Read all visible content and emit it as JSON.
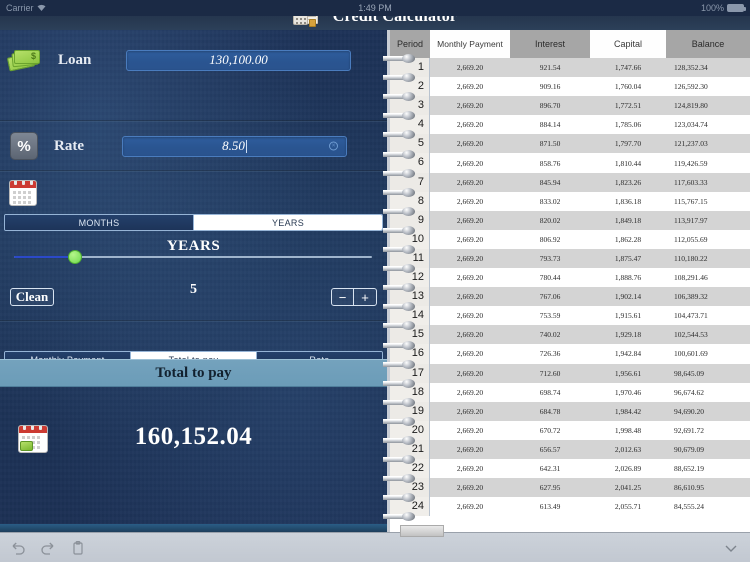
{
  "status_bar": {
    "carrier": "Carrier",
    "time": "1:49 PM",
    "battery": "100%"
  },
  "header": {
    "title": "Credit Calculator",
    "icon": "calculator-receipt-icon"
  },
  "left_panel": {
    "loan": {
      "icon": "money-bills-icon",
      "label": "Loan",
      "value": "130,100.00"
    },
    "rate": {
      "icon": "percent-icon",
      "label": "Rate",
      "value": "8.50"
    },
    "term": {
      "icon": "calendar-icon",
      "segments": [
        {
          "label": "MONTHS",
          "selected": false
        },
        {
          "label": "YEARS",
          "selected": true
        }
      ],
      "title": "YEARS",
      "value": "5",
      "slider_percent": 17,
      "clean_label": "Clean",
      "stepper_minus": "−",
      "stepper_plus": "+"
    },
    "result": {
      "segments": [
        {
          "label": "Monthly Payment",
          "selected": false
        },
        {
          "label": "Total to pay",
          "selected": true
        },
        {
          "label": "Rate",
          "selected": false
        }
      ],
      "header": "Total to pay",
      "icon": "calendar-money-icon",
      "value": "160,152.04"
    }
  },
  "table": {
    "columns": [
      {
        "label": "Period",
        "style": "gray"
      },
      {
        "label": "Monthly Payment",
        "style": "white"
      },
      {
        "label": "Interest",
        "style": "gray"
      },
      {
        "label": "Capital",
        "style": "white"
      },
      {
        "label": "Balance",
        "style": "gray"
      }
    ],
    "rows": [
      [
        "1",
        "2,669.20",
        "921.54",
        "1,747.66",
        "128,352.34"
      ],
      [
        "2",
        "2,669.20",
        "909.16",
        "1,760.04",
        "126,592.30"
      ],
      [
        "3",
        "2,669.20",
        "896.70",
        "1,772.51",
        "124,819.80"
      ],
      [
        "4",
        "2,669.20",
        "884.14",
        "1,785.06",
        "123,034.74"
      ],
      [
        "5",
        "2,669.20",
        "871.50",
        "1,797.70",
        "121,237.03"
      ],
      [
        "6",
        "2,669.20",
        "858.76",
        "1,810.44",
        "119,426.59"
      ],
      [
        "7",
        "2,669.20",
        "845.94",
        "1,823.26",
        "117,603.33"
      ],
      [
        "8",
        "2,669.20",
        "833.02",
        "1,836.18",
        "115,767.15"
      ],
      [
        "9",
        "2,669.20",
        "820.02",
        "1,849.18",
        "113,917.97"
      ],
      [
        "10",
        "2,669.20",
        "806.92",
        "1,862.28",
        "112,055.69"
      ],
      [
        "11",
        "2,669.20",
        "793.73",
        "1,875.47",
        "110,180.22"
      ],
      [
        "12",
        "2,669.20",
        "780.44",
        "1,888.76",
        "108,291.46"
      ],
      [
        "13",
        "2,669.20",
        "767.06",
        "1,902.14",
        "106,389.32"
      ],
      [
        "14",
        "2,669.20",
        "753.59",
        "1,915.61",
        "104,473.71"
      ],
      [
        "15",
        "2,669.20",
        "740.02",
        "1,929.18",
        "102,544.53"
      ],
      [
        "16",
        "2,669.20",
        "726.36",
        "1,942.84",
        "100,601.69"
      ],
      [
        "17",
        "2,669.20",
        "712.60",
        "1,956.61",
        "98,645.09"
      ],
      [
        "18",
        "2,669.20",
        "698.74",
        "1,970.46",
        "96,674.62"
      ],
      [
        "19",
        "2,669.20",
        "684.78",
        "1,984.42",
        "94,690.20"
      ],
      [
        "20",
        "2,669.20",
        "670.72",
        "1,998.48",
        "92,691.72"
      ],
      [
        "21",
        "2,669.20",
        "656.57",
        "2,012.63",
        "90,679.09"
      ],
      [
        "22",
        "2,669.20",
        "642.31",
        "2,026.89",
        "88,652.19"
      ],
      [
        "23",
        "2,669.20",
        "627.95",
        "2,041.25",
        "86,610.95"
      ],
      [
        "24",
        "2,669.20",
        "613.49",
        "2,055.71",
        "84,555.24"
      ]
    ]
  },
  "bottom_bar": {
    "icons": [
      "undo-icon",
      "redo-icon",
      "paste-icon"
    ],
    "collapse": "chevron-down-icon"
  }
}
